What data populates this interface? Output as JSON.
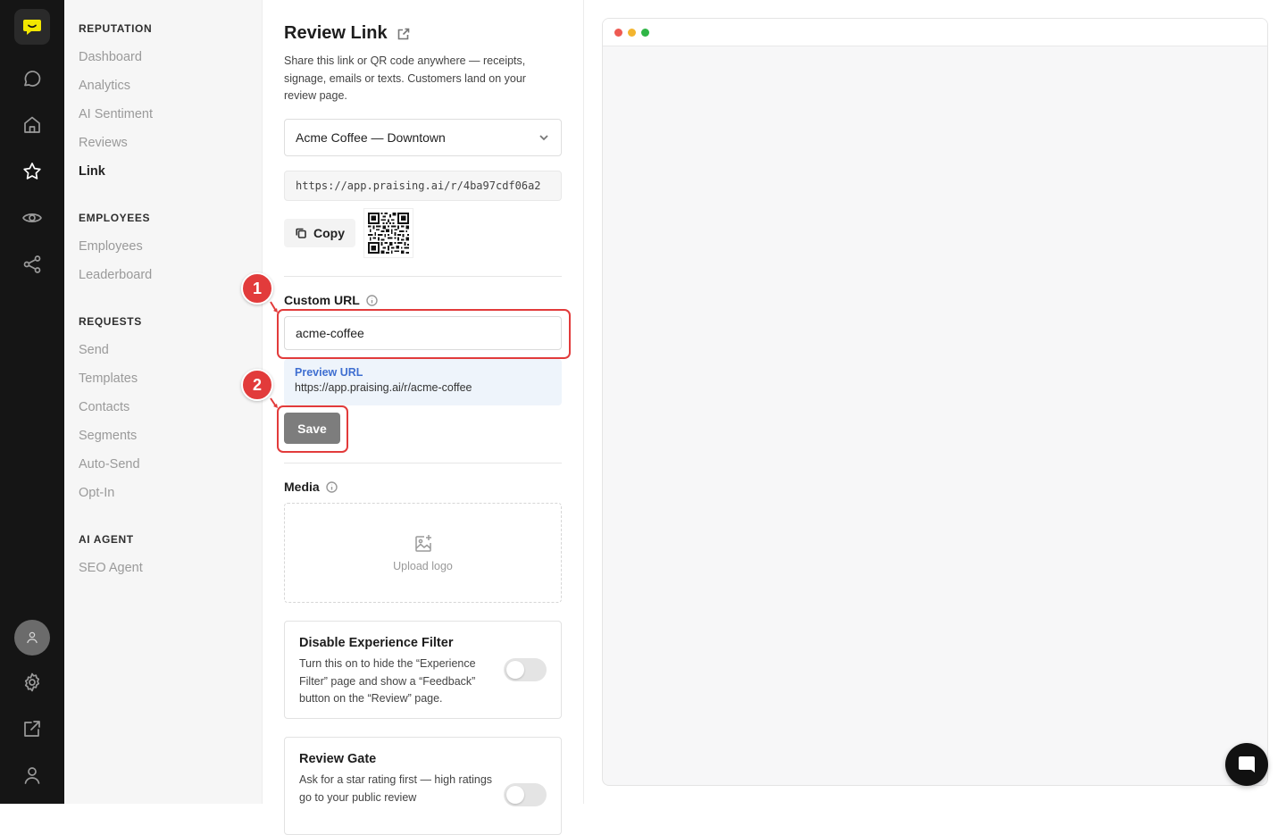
{
  "nav": {
    "sections": [
      {
        "title": "REPUTATION",
        "items": [
          "Dashboard",
          "Analytics",
          "AI Sentiment",
          "Reviews",
          "Link"
        ]
      },
      {
        "title": "EMPLOYEES",
        "items": [
          "Employees",
          "Leaderboard"
        ]
      },
      {
        "title": "REQUESTS",
        "items": [
          "Send",
          "Templates",
          "Contacts",
          "Segments",
          "Auto-Send",
          "Opt-In"
        ]
      },
      {
        "title": "AI AGENT",
        "items": [
          "SEO Agent"
        ]
      }
    ],
    "active_item": "Link"
  },
  "rail": {
    "icons": [
      "logo-icon",
      "chat-icon",
      "home-icon",
      "star-icon",
      "eye-icon",
      "share-icon",
      "avatar",
      "gear-icon",
      "external-link-icon",
      "user-icon"
    ],
    "active_icon": "star-icon"
  },
  "page": {
    "title": "Review Link",
    "description": "Share this link or QR code anywhere — receipts, signage, emails or texts. Customers land on your review page.",
    "location_select": "Acme Coffee — Downtown",
    "review_url": "https://app.praising.ai/r/4ba97cdf06a2",
    "copy_label": "Copy",
    "custom_url_label": "Custom URL",
    "custom_url_value": "acme-coffee",
    "preview_label": "Preview URL",
    "preview_url": "https://app.praising.ai/r/acme-coffee",
    "save_label": "Save",
    "media_label": "Media",
    "upload_label": "Upload logo",
    "experience_filter": {
      "title": "Disable Experience Filter",
      "description": "Turn this on to hide the “Experience Filter” page and show a “Feedback” button on the “Review” page.",
      "enabled": false
    },
    "review_gate": {
      "title": "Review Gate",
      "description": "Ask for a star rating first — high ratings go to your public review",
      "enabled": false
    }
  },
  "annotations": [
    {
      "number": "1",
      "target": "custom-url-input"
    },
    {
      "number": "2",
      "target": "save-button"
    }
  ],
  "colors": {
    "rail_bg": "#151515",
    "accent_logo": "#f2e600",
    "annotation": "#e23b3b",
    "preview_link": "#3f6fd1",
    "save_button": "#7d7d7d",
    "window_dots": [
      "#ee5a52",
      "#f3b52f",
      "#2fb546"
    ]
  }
}
